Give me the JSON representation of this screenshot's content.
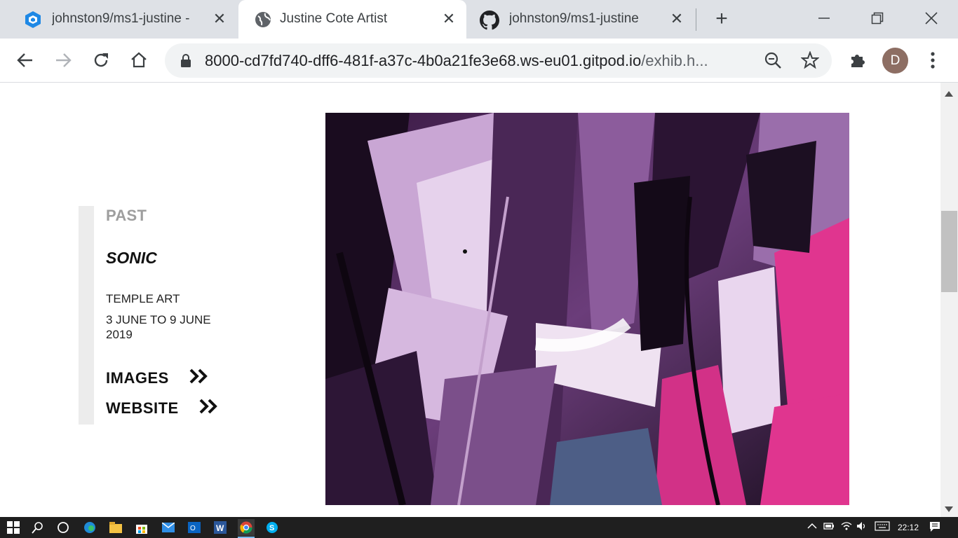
{
  "browser": {
    "tabs": [
      {
        "title": "johnston9/ms1-justine -",
        "icon": "gitpod-icon",
        "active": false
      },
      {
        "title": "Justine Cote Artist",
        "icon": "globe-icon",
        "active": true
      },
      {
        "title": "johnston9/ms1-justine",
        "icon": "github-icon",
        "active": false
      }
    ],
    "url_host": "8000-cd7fd740-dff6-481f-a37c-4b0a21fe3e68.ws-eu01.gitpod.io",
    "url_path": "/exhib.h...",
    "profile_initial": "D"
  },
  "exhibition": {
    "status": "PAST",
    "title": "SONIC",
    "venue": "TEMPLE ART",
    "dates": "3 JUNE TO 9 JUNE 2019",
    "images_label": "IMAGES",
    "website_label": "WEBSITE",
    "artwork_description": "abstract-painting"
  },
  "taskbar": {
    "time": "22:12",
    "apps": [
      "start-icon",
      "search-icon",
      "task-view-icon",
      "edge-icon",
      "file-explorer-icon",
      "store-icon",
      "mail-icon",
      "outlook-icon",
      "word-icon",
      "chrome-icon",
      "skype-icon"
    ]
  },
  "colors": {
    "tab_bar": "#dee1e6",
    "accent_bar": "#ececec",
    "status_gray": "#9e9e9e",
    "art_purple": "#7a4a86",
    "art_pink": "#e0358f"
  }
}
